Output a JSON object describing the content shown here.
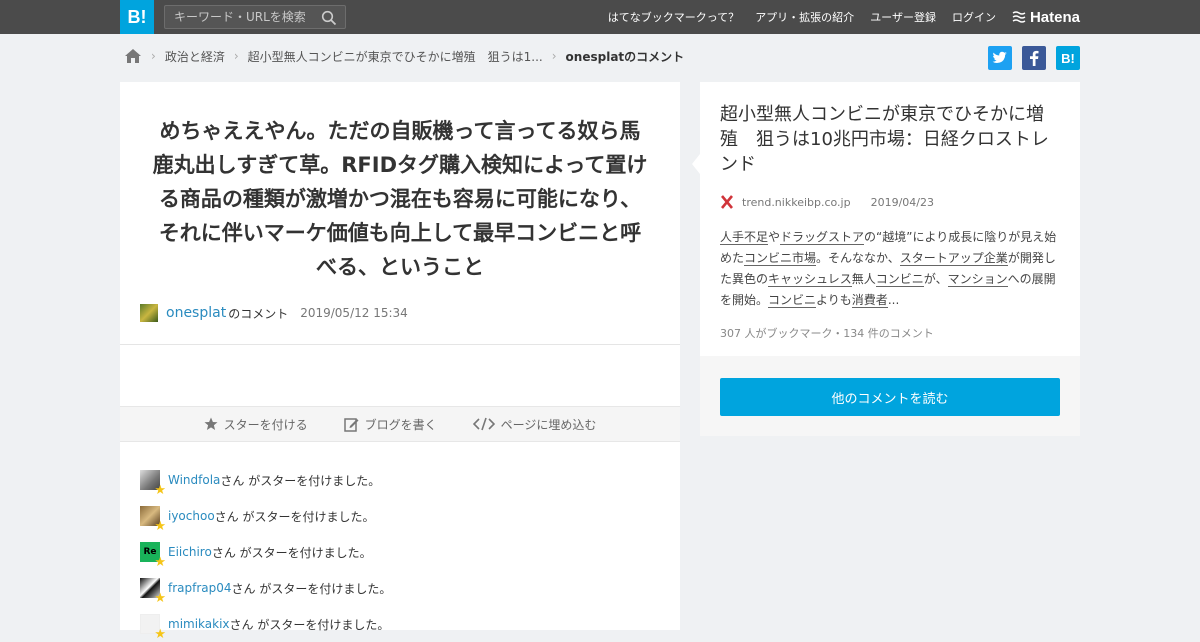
{
  "header": {
    "logo": "B!",
    "search_placeholder": "キーワード・URLを検索",
    "nav": [
      "はてなブックマークって？",
      "アプリ・拡張の紹介",
      "ユーザー登録",
      "ログイン"
    ],
    "brand": "Hatena"
  },
  "breadcrumb": {
    "items": [
      "政治と経済",
      "超小型無人コンビニが東京でひそかに増殖　狙うは1..."
    ],
    "current": "onesplatのコメント"
  },
  "share": {
    "twitter_color": "#1da1f2",
    "facebook_color": "#3b5998",
    "hatena_color": "#00a4de",
    "hatena_label": "B!"
  },
  "comment": {
    "text": "めちゃええやん。ただの自販機って言ってる奴ら馬鹿丸出しすぎて草。RFIDタグ購入検知によって置ける商品の種類が激増かつ混在も容易に可能になり、それに伴いマーケ価値も向上して最早コンビニと呼べる、ということ",
    "user": "onesplat",
    "user_suffix": "のコメント",
    "date": "2019/05/12 15:34"
  },
  "actions": {
    "star": "スターを付ける",
    "blog": "ブログを書く",
    "embed": "ページに埋め込む"
  },
  "stars": [
    {
      "user": "Windfola",
      "text": "さん がスターを付けました。"
    },
    {
      "user": "iyochoo",
      "text": "さん がスターを付けました。"
    },
    {
      "user": "Eiichiro",
      "text": "さん がスターを付けました。"
    },
    {
      "user": "frapfrap04",
      "text": "さん がスターを付けました。"
    },
    {
      "user": "mimikakix",
      "text": "さん がスターを付けました。"
    }
  ],
  "entry": {
    "title": "超小型無人コンビニが東京でひそかに増殖　狙うは10兆円市場：日経クロストレンド",
    "domain": "trend.nikkeibp.co.jp",
    "date": "2019/04/23",
    "desc_parts": [
      {
        "t": "人手不足",
        "u": true
      },
      {
        "t": "や",
        "u": false
      },
      {
        "t": "ドラッグストア",
        "u": true
      },
      {
        "t": "の“越境”により成長に陰りが見え始めた",
        "u": false
      },
      {
        "t": "コンビニ市場",
        "u": true
      },
      {
        "t": "。そんななか、",
        "u": false
      },
      {
        "t": "スタートアップ企業",
        "u": true
      },
      {
        "t": "が開発した異色の",
        "u": false
      },
      {
        "t": "キャッシュレス",
        "u": true
      },
      {
        "t": "無人",
        "u": false
      },
      {
        "t": "コンビニ",
        "u": true
      },
      {
        "t": "が、",
        "u": false
      },
      {
        "t": "マンション",
        "u": true
      },
      {
        "t": "への展開を開始。",
        "u": false
      },
      {
        "t": "コンビニ",
        "u": true
      },
      {
        "t": "よりも",
        "u": false
      },
      {
        "t": "消費者",
        "u": true
      },
      {
        "t": "...",
        "u": false
      }
    ],
    "counts": "307 人がブックマーク・134 件のコメント"
  },
  "read_button": "他のコメントを読む"
}
